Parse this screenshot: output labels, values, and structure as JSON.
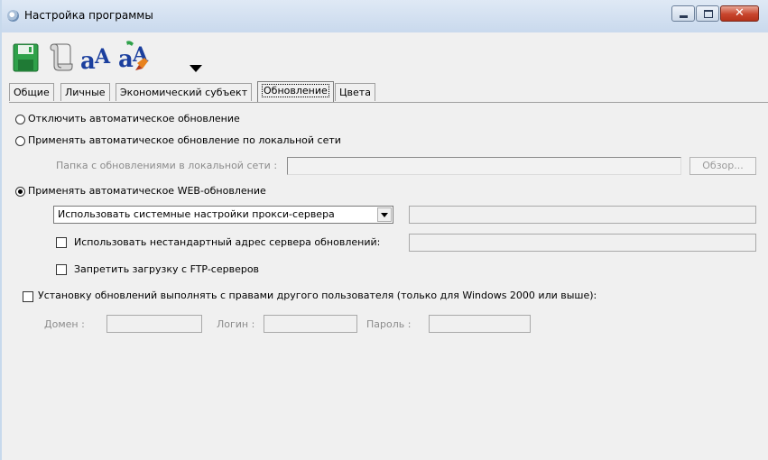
{
  "window": {
    "title": "Настройка программы",
    "close_glyph": "✕"
  },
  "toolbar": {
    "items": [
      "save-icon",
      "scroll-icon",
      "font-icon",
      "font-color-icon",
      "dropdown-arrow-icon"
    ]
  },
  "tabs": [
    {
      "label": "Общие"
    },
    {
      "label": "Личные"
    },
    {
      "label": "Экономический субъект"
    },
    {
      "label": "Обновление"
    },
    {
      "label": "Цвета"
    }
  ],
  "update": {
    "opt_disable": "Отключить автоматическое обновление",
    "opt_lan": "Применять автоматическое обновление по локальной сети",
    "lan_folder_label": "Папка с обновлениями в локальной сети :",
    "lan_folder_value": "",
    "browse_label": "Обзор...",
    "opt_web": "Применять автоматическое WEB-обновление",
    "selected_option": "opt_web",
    "proxy_select_value": "Использовать системные настройки прокси-сервера",
    "proxy_extra_value": "",
    "custom_server_label": "Использовать нестандартный адрес сервера обновлений:",
    "custom_server_checked": false,
    "custom_server_value": "",
    "ftp_label": "Запретить загрузку с FTP-серверов",
    "ftp_checked": false,
    "other_user_label": "Установку обновлений выполнять с правами другого пользователя (только для Windows 2000 или выше):",
    "other_user_checked": false,
    "domain_label": "Домен :",
    "domain_value": "",
    "login_label": "Логин :",
    "login_value": "",
    "password_label": "Пароль :",
    "password_value": ""
  }
}
